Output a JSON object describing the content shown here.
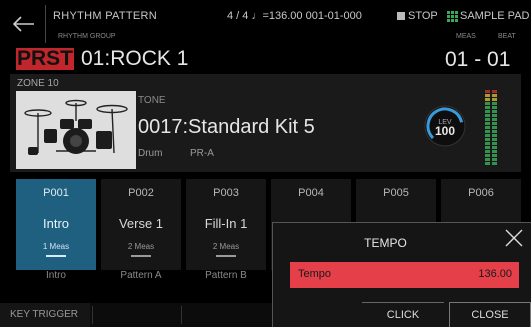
{
  "header": {
    "title": "RHYTHM PATTERN",
    "status": "4 / 4 ♩=136.00   001-01-000",
    "stop_label": "STOP",
    "sample_pad_label": "SAMPLE PAD",
    "group_label": "RHYTHM GROUP",
    "meas_label": "MEAS",
    "beat_label": "BEAT",
    "prst_badge": "PRST",
    "pattern_name": "01:ROCK 1",
    "meas_beat_value": "01 - 01"
  },
  "zone": {
    "label": "ZONE 10",
    "tone_label": "TONE",
    "tone_name": "0017:Standard Kit 5",
    "category": "Drum",
    "bank": "PR-A",
    "lev_label": "LEV",
    "lev_value": "100",
    "lev_level": 100
  },
  "pads": [
    {
      "num": "P001",
      "name": "Intro",
      "meas": "1 Meas",
      "label": "Intro",
      "active": true
    },
    {
      "num": "P002",
      "name": "Verse 1",
      "meas": "2 Meas",
      "label": "Pattern A",
      "active": false
    },
    {
      "num": "P003",
      "name": "Fill-In 1",
      "meas": "2 Meas",
      "label": "Pattern B",
      "active": false
    },
    {
      "num": "P004",
      "name": "",
      "meas": "",
      "label": "",
      "active": false
    },
    {
      "num": "P005",
      "name": "",
      "meas": "",
      "label": "",
      "active": false
    },
    {
      "num": "P006",
      "name": "",
      "meas": "",
      "label": "",
      "active": false
    }
  ],
  "footer": {
    "key_trigger": "KEY TRIGGER"
  },
  "tempo_dialog": {
    "title": "TEMPO",
    "field_label": "Tempo",
    "field_value": "136.00",
    "click_label": "CLICK",
    "close_label": "CLOSE"
  },
  "colors": {
    "accent_red": "#c0262c",
    "tempo_field": "#e5404a",
    "active_pad": "#1f5f7f",
    "meter_green": "#3aa858",
    "knob_blue": "#3a9ad9"
  },
  "icons": {
    "back": "arrow-left-icon",
    "close": "close-x-icon",
    "sample_pad": "grid-icon"
  }
}
